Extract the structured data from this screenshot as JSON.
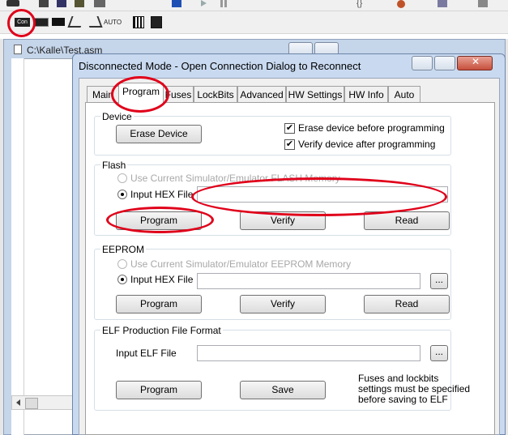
{
  "toolbar": {
    "con_label": "Con",
    "auto_label": "AUTO",
    "icons": [
      "connect-icon",
      "hvr-icon",
      "chip-icon",
      "step-into-icon",
      "step-out-icon",
      "auto-icon",
      "memory-icon",
      "upload-icon"
    ]
  },
  "editor": {
    "title": "C:\\Kalle\\Test.asm"
  },
  "dialog": {
    "title": "Disconnected Mode - Open Connection Dialog to Reconnect",
    "tabs": [
      {
        "label": "Main"
      },
      {
        "label": "Program"
      },
      {
        "label": "Fuses"
      },
      {
        "label": "LockBits"
      },
      {
        "label": "Advanced"
      },
      {
        "label": "HW Settings"
      },
      {
        "label": "HW Info"
      },
      {
        "label": "Auto"
      }
    ],
    "active_tab": "Program"
  },
  "device": {
    "legend": "Device",
    "erase_button": "Erase Device",
    "erase_before_label": "Erase device before programming",
    "erase_before_checked": true,
    "verify_after_label": "Verify device after programming",
    "verify_after_checked": true
  },
  "flash": {
    "legend": "Flash",
    "use_simulator_label": "Use Current Simulator/Emulator FLASH Memory",
    "input_hex_label": "Input HEX File",
    "input_hex_value": "",
    "program_button": "Program",
    "verify_button": "Verify",
    "read_button": "Read"
  },
  "eeprom": {
    "legend": "EEPROM",
    "use_simulator_label": "Use Current Simulator/Emulator EEPROM Memory",
    "input_hex_label": "Input HEX File",
    "input_hex_value": "",
    "browse_button": "...",
    "program_button": "Program",
    "verify_button": "Verify",
    "read_button": "Read"
  },
  "elf": {
    "legend": "ELF Production File Format",
    "input_elf_label": "Input ELF File",
    "input_elf_value": "",
    "browse_button": "...",
    "program_button": "Program",
    "save_button": "Save",
    "note": "Fuses and lockbits settings must be specified before saving to ELF"
  },
  "colors": {
    "annotation_red": "#e0001a",
    "dialog_frame": "#c9daf0"
  }
}
